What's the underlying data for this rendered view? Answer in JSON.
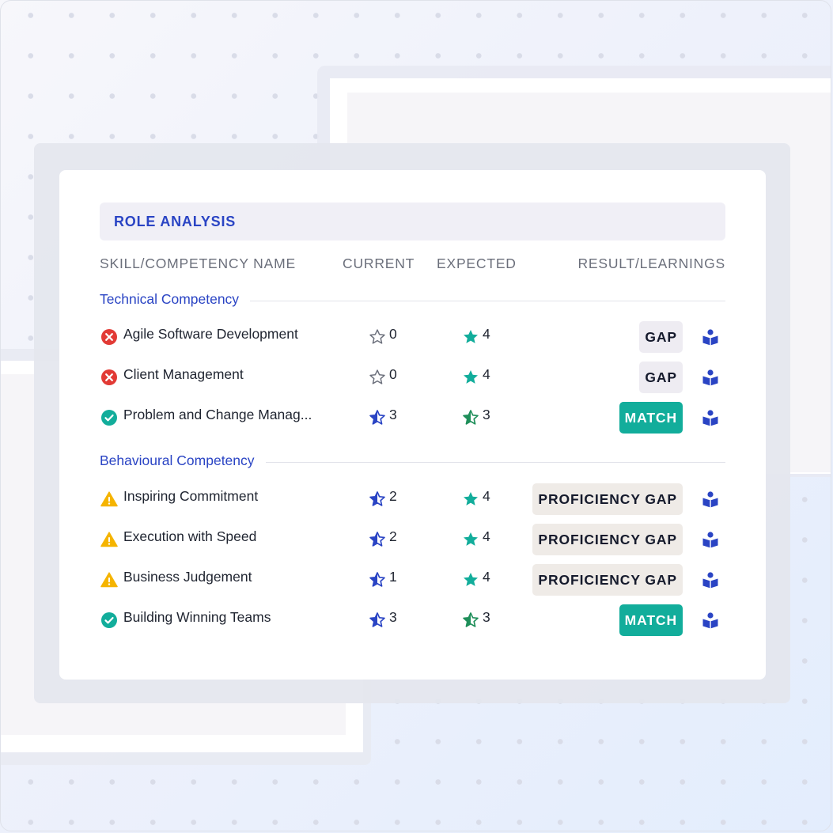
{
  "title": "ROLE ANALYSIS",
  "columns": {
    "skill": "SKILL/COMPETENCY NAME",
    "current": "CURRENT",
    "expected": "EXPECTED",
    "result": "RESULT/LEARNINGS"
  },
  "sections": [
    {
      "label": "Technical Competency"
    },
    {
      "label": "Behavioural Competency"
    }
  ],
  "rows": [
    {
      "status": "error-icon",
      "name": "Agile Software Development",
      "current": "0",
      "current_icon": "star-outline-icon",
      "expected": "4",
      "expected_icon": "star-filled-icon",
      "result": "GAP",
      "result_type": "gap"
    },
    {
      "status": "error-icon",
      "name": "Client Management",
      "current": "0",
      "current_icon": "star-outline-icon",
      "expected": "4",
      "expected_icon": "star-filled-icon",
      "result": "GAP",
      "result_type": "gap"
    },
    {
      "status": "check-icon",
      "name": "Problem and Change Manag...",
      "current": "3",
      "current_icon": "star-half-icon",
      "expected": "3",
      "expected_icon": "star-half-icon",
      "result": "MATCH",
      "result_type": "match"
    },
    {
      "status": "warning-icon",
      "name": "Inspiring Commitment",
      "current": "2",
      "current_icon": "star-half-icon",
      "expected": "4",
      "expected_icon": "star-filled-icon",
      "result": "PROFICIENCY GAP",
      "result_type": "pgap"
    },
    {
      "status": "warning-icon",
      "name": "Execution with Speed",
      "current": "2",
      "current_icon": "star-half-icon",
      "expected": "4",
      "expected_icon": "star-filled-icon",
      "result": "PROFICIENCY GAP",
      "result_type": "pgap"
    },
    {
      "status": "warning-icon",
      "name": "Business Judgement",
      "current": "1",
      "current_icon": "star-half-icon",
      "expected": "4",
      "expected_icon": "star-filled-icon",
      "result": "PROFICIENCY GAP",
      "result_type": "pgap"
    },
    {
      "status": "check-icon",
      "name": "Building Winning Teams",
      "current": "3",
      "current_icon": "star-half-icon",
      "expected": "3",
      "expected_icon": "star-half-icon",
      "result": "MATCH",
      "result_type": "match"
    }
  ],
  "icons": {
    "learning": "book-reader-icon"
  },
  "colors": {
    "title": "#2a44c4",
    "section": "#2a44c4",
    "current_star": "#2a44c4",
    "expected_star": "#12ad9b",
    "match_badge": "#12ad9b",
    "error": "#e23a35",
    "warning": "#f5b400",
    "check": "#12ad9b"
  }
}
